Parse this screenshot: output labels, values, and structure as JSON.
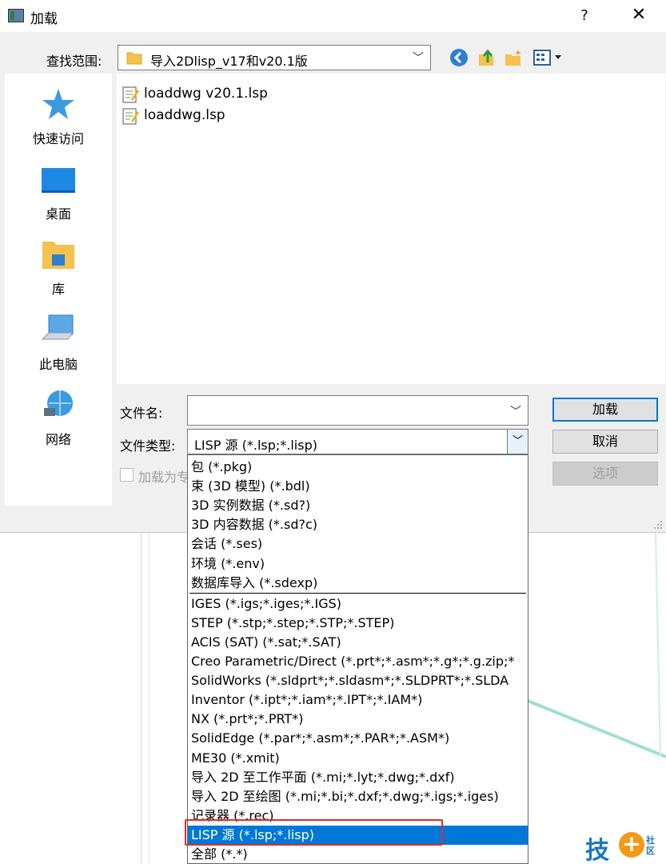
{
  "window": {
    "title": "加载",
    "help_label": "?",
    "close_label": "✕"
  },
  "look_in": {
    "label": "查找范围:",
    "value": "导入2Dlisp_v17和v20.1版"
  },
  "places": [
    {
      "label": "快速访问",
      "icon": "star-icon"
    },
    {
      "label": "桌面",
      "icon": "desktop-icon"
    },
    {
      "label": "库",
      "icon": "library-icon"
    },
    {
      "label": "此电脑",
      "icon": "computer-icon"
    },
    {
      "label": "网络",
      "icon": "network-icon"
    }
  ],
  "files": [
    {
      "name": "loaddwg v20.1.lsp",
      "icon": "lisp-file-icon"
    },
    {
      "name": "loaddwg.lsp",
      "icon": "lisp-file-icon"
    }
  ],
  "file_name": {
    "label": "文件名:",
    "value": ""
  },
  "file_type": {
    "label": "文件类型:",
    "value": "LISP 源 (*.lsp;*.lisp)"
  },
  "readonly": {
    "label": "加载为专"
  },
  "buttons": {
    "load": "加载",
    "cancel": "取消",
    "options": "选项"
  },
  "dropdown_items": [
    "包 (*.pkg)",
    "束 (3D 模型) (*.bdl)",
    "3D 实例数据 (*.sd?)",
    "3D 内容数据 (*.sd?c)",
    "会话 (*.ses)",
    "环境 (*.env)",
    "数据库导入 (*.sdexp)",
    "IGES (*.igs;*.iges;*.IGS)",
    "STEP (*.stp;*.step;*.STP;*.STEP)",
    "ACIS (SAT) (*.sat;*.SAT)",
    "Creo Parametric/Direct (*.prt*;*.asm*;*.g*;*.g.zip;*",
    "SolidWorks (*.sldprt*;*.sldasm*;*.SLDPRT*;*.SLDA",
    "Inventor (*.ipt*;*.iam*;*.IPT*;*.IAM*)",
    "NX (*.prt*;*.PRT*)",
    "SolidEdge (*.par*;*.asm*;*.PAR*;*.ASM*)",
    "ME30 (*.xmit)",
    "导入 2D 至工作平面 (*.mi;*.lyt;*.dwg;*.dxf)",
    "导入 2D 至绘图 (*.mi;*.bi;*.dxf;*.dwg;*.igs;*.iges)",
    "记录器 (*.rec)",
    "LISP 源 (*.lsp;*.lisp)",
    "全部 (*.*)"
  ],
  "selected_index": 19,
  "watermark": {
    "main": "技",
    "plus": "+",
    "sub": "社区"
  },
  "colors": {
    "accent": "#0078d7",
    "highlight_box": "#e02b2b",
    "watermark_blue": "#1a78c2",
    "watermark_orange": "#f29a17"
  }
}
